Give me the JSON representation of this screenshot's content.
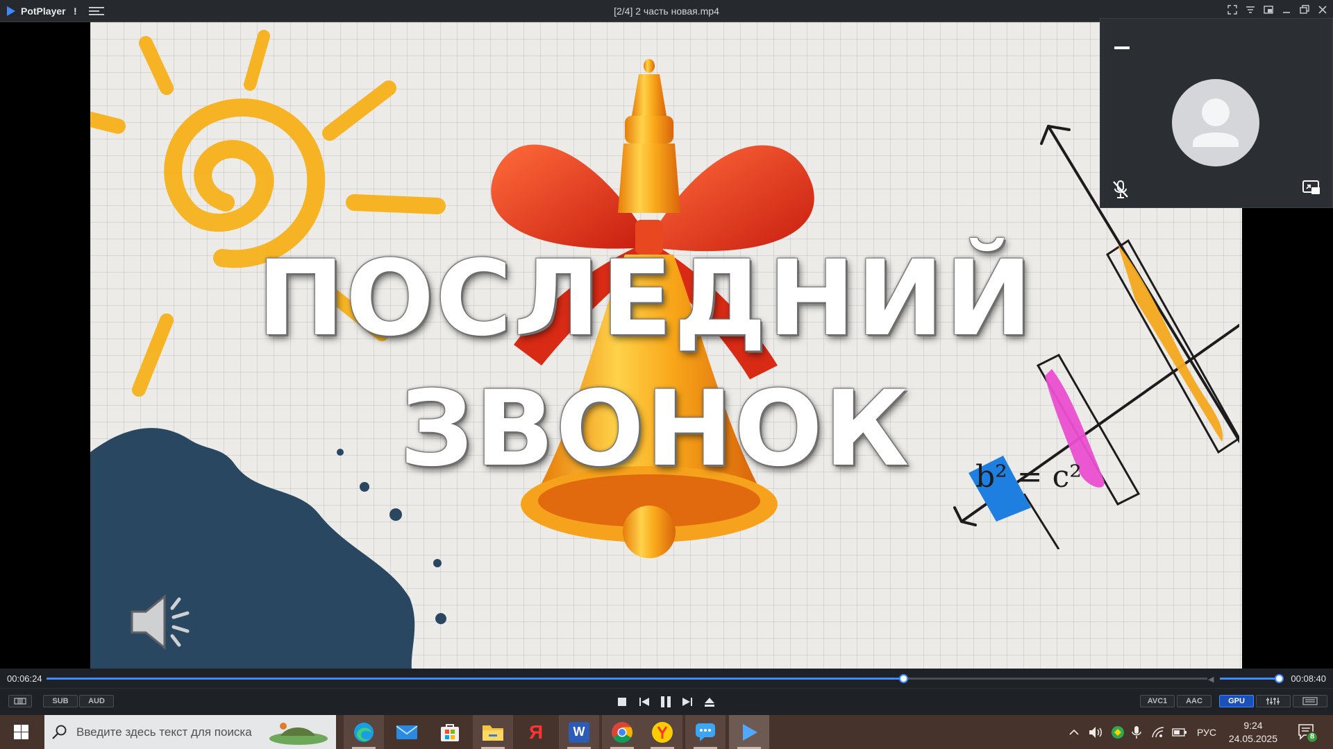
{
  "window": {
    "app_name": "PotPlayer",
    "excl": "!",
    "title": "[2/4] 2 часть новая.mp4",
    "controls": [
      "fullscreen-icon",
      "menu-icon",
      "pip-icon",
      "minimize-icon",
      "restore-icon",
      "close-icon"
    ]
  },
  "video": {
    "title_line1": "ПОСЛЕДНИЙ",
    "title_line2": "ЗВОНОК",
    "formula": "b² = c²"
  },
  "call_overlay": {
    "mic_state": "muted"
  },
  "seek": {
    "current_time": "00:06:24",
    "total_time": "00:08:40",
    "progress": 0.738,
    "volume": 0.97
  },
  "controls": {
    "left_buttons": [
      "SUB",
      "AUD"
    ],
    "right_buttons": [
      "AVC1",
      "AAC",
      "GPU"
    ]
  },
  "taskbar": {
    "search_placeholder": "Введите здесь текст для поиска",
    "apps": [
      "edge",
      "mail",
      "store",
      "explorer",
      "yandex",
      "word",
      "chrome",
      "yandex-browser",
      "messenger",
      "potplayer"
    ],
    "language": "РУС",
    "time": "9:24",
    "date": "24.05.2025",
    "notification_count": "8"
  },
  "colors": {
    "accent": "#3d8bff",
    "titlebar": "#26292e",
    "taskbar": "#45332c"
  }
}
